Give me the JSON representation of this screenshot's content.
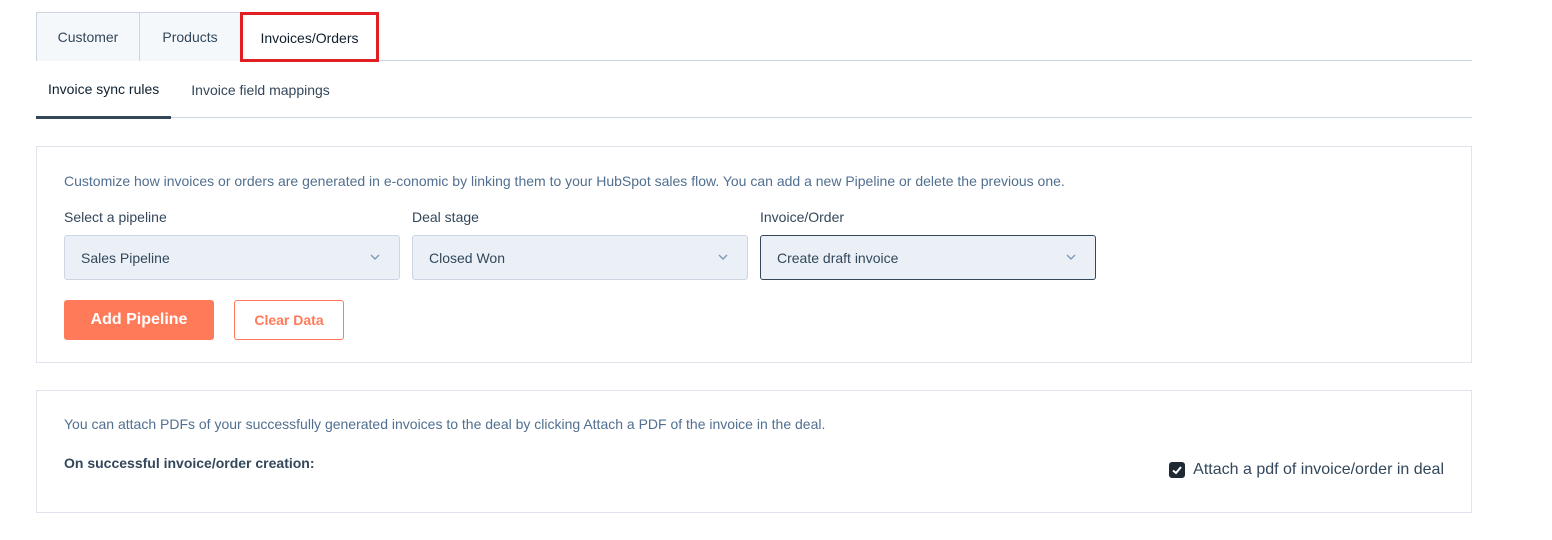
{
  "tabs": [
    {
      "label": "Customer"
    },
    {
      "label": "Products"
    },
    {
      "label": "Invoices/Orders"
    }
  ],
  "subtabs": [
    {
      "label": "Invoice sync rules"
    },
    {
      "label": "Invoice field mappings"
    }
  ],
  "sync_rules": {
    "description": "Customize how invoices or orders are generated in e-conomic by linking them to your HubSpot sales flow. You can add a new Pipeline or delete the previous one.",
    "pipeline": {
      "label": "Select a pipeline",
      "value": "Sales Pipeline"
    },
    "deal_stage": {
      "label": "Deal stage",
      "value": "Closed Won"
    },
    "invoice_order": {
      "label": "Invoice/Order",
      "value": "Create draft invoice"
    },
    "add_pipeline_label": "Add Pipeline",
    "clear_data_label": "Clear Data"
  },
  "attach": {
    "description": "You can attach PDFs of your successfully generated invoices to the deal by clicking Attach a PDF of the invoice in the deal.",
    "on_success_label": "On successful invoice/order creation:",
    "checkbox_label": "Attach a pdf of invoice/order in deal",
    "checked": true
  },
  "colors": {
    "accent": "#ff7a59",
    "highlight": "#e01e24",
    "select_bg": "#eaf0f6"
  }
}
